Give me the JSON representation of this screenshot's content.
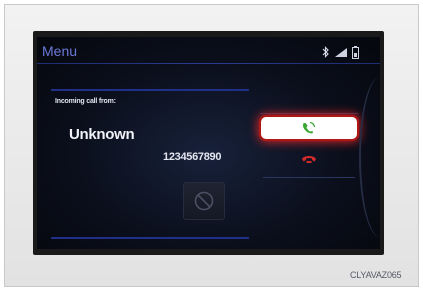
{
  "header": {
    "title": "Menu",
    "status_icons": [
      "bluetooth-icon",
      "signal-strength-icon",
      "battery-icon"
    ]
  },
  "call": {
    "label": "Incoming call from:",
    "caller_name": "Unknown",
    "caller_number": "1234567890"
  },
  "buttons": {
    "accept": {
      "icon": "phone-accept-icon",
      "color": "#3aa832"
    },
    "decline": {
      "icon": "phone-decline-icon",
      "color": "#d42a2a"
    },
    "mute": {
      "icon": "prohibited-icon"
    }
  },
  "colors": {
    "accent": "#6a79d8",
    "highlight": "#e02828"
  },
  "caption": "CLYAVAZ065"
}
